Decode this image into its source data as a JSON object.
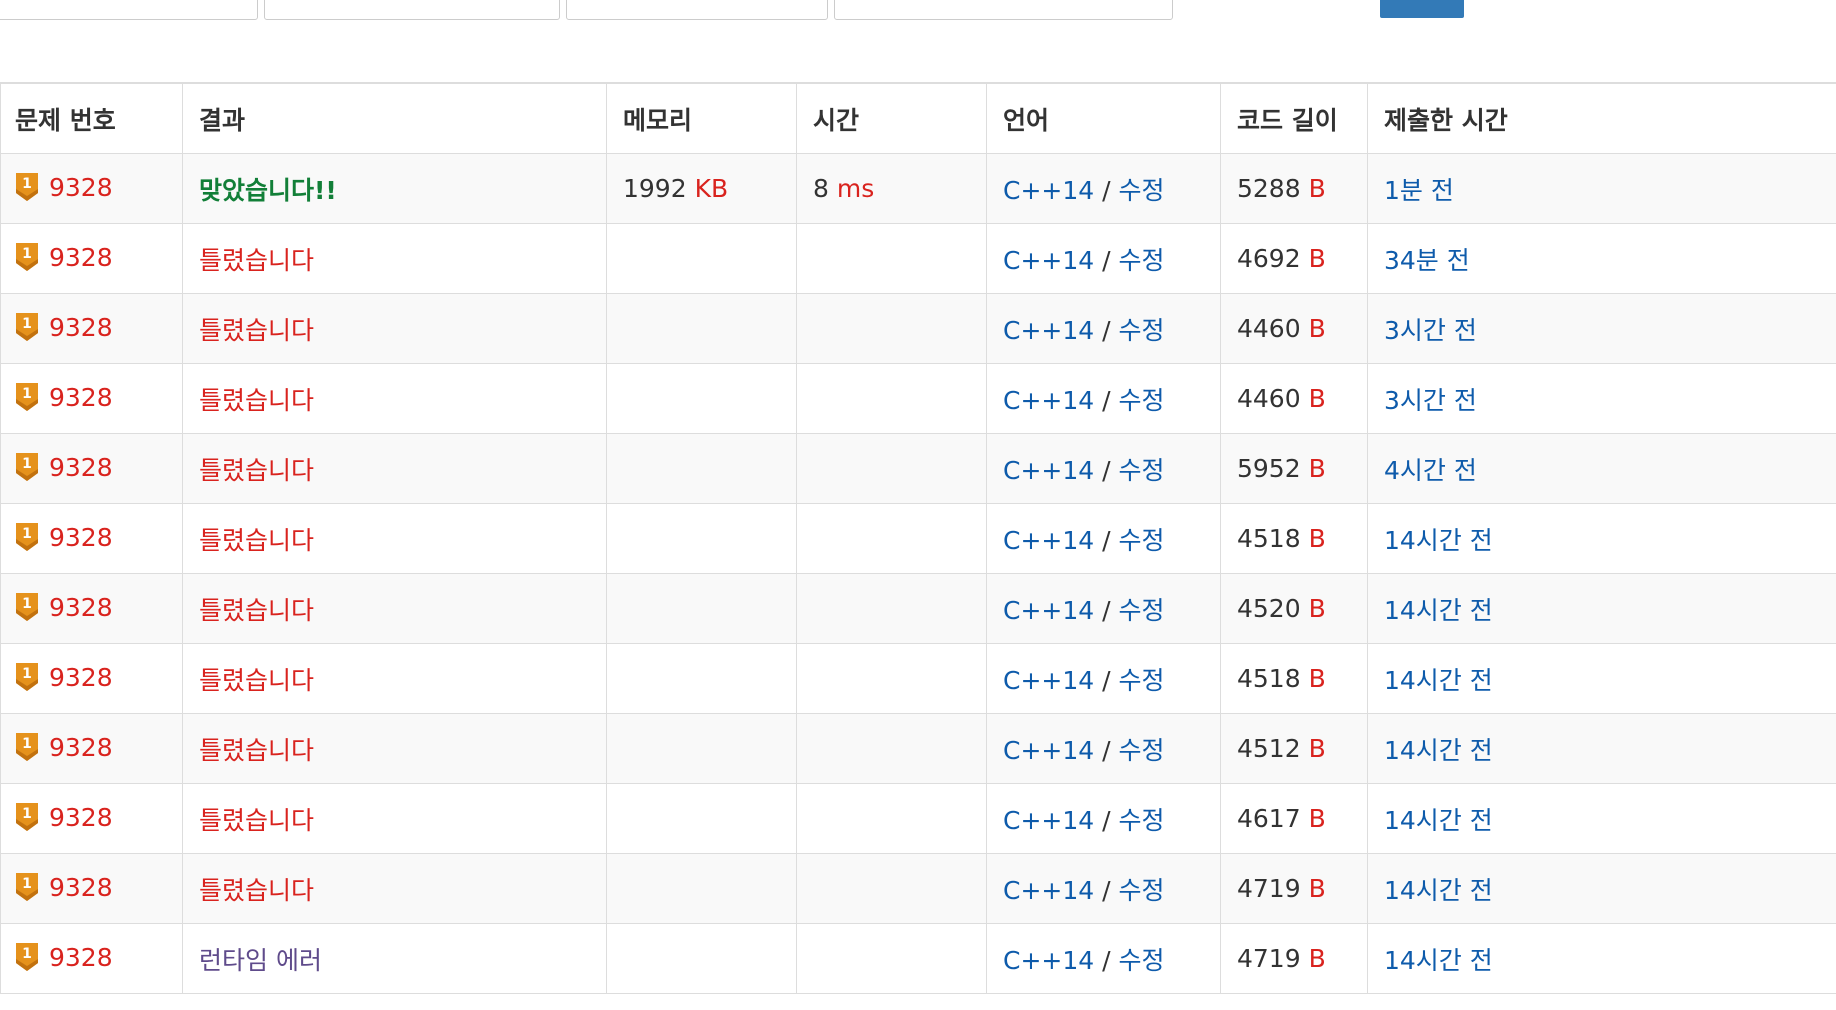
{
  "colors": {
    "accent": "#337ab7",
    "link": "#0e5bab",
    "unit_red": "#d9231e",
    "accepted_green": "#127f38",
    "runtime_error": "#5f4b8b",
    "tier_badge": "#e5921c"
  },
  "headers": {
    "problem": "문제 번호",
    "result": "결과",
    "memory": "메모리",
    "time": "시간",
    "language": "언어",
    "code_length": "코드 길이",
    "submitted": "제출한 시간"
  },
  "rows": [
    {
      "problem_id": "9328",
      "tier_icon": "silver-1-badge-icon",
      "result": "맞았습니다!!",
      "status": "ok",
      "memory": "1992",
      "memory_unit": "KB",
      "time": "8",
      "time_unit": "ms",
      "language": "C++14",
      "separator": "/",
      "edit": "수정",
      "code_length": "5288",
      "length_unit": "B",
      "submitted": "1분 전"
    },
    {
      "problem_id": "9328",
      "tier_icon": "silver-1-badge-icon",
      "result": "틀렸습니다",
      "status": "wa",
      "memory": "",
      "memory_unit": "",
      "time": "",
      "time_unit": "",
      "language": "C++14",
      "separator": "/",
      "edit": "수정",
      "code_length": "4692",
      "length_unit": "B",
      "submitted": "34분 전"
    },
    {
      "problem_id": "9328",
      "tier_icon": "silver-1-badge-icon",
      "result": "틀렸습니다",
      "status": "wa",
      "memory": "",
      "memory_unit": "",
      "time": "",
      "time_unit": "",
      "language": "C++14",
      "separator": "/",
      "edit": "수정",
      "code_length": "4460",
      "length_unit": "B",
      "submitted": "3시간 전"
    },
    {
      "problem_id": "9328",
      "tier_icon": "silver-1-badge-icon",
      "result": "틀렸습니다",
      "status": "wa",
      "memory": "",
      "memory_unit": "",
      "time": "",
      "time_unit": "",
      "language": "C++14",
      "separator": "/",
      "edit": "수정",
      "code_length": "4460",
      "length_unit": "B",
      "submitted": "3시간 전"
    },
    {
      "problem_id": "9328",
      "tier_icon": "silver-1-badge-icon",
      "result": "틀렸습니다",
      "status": "wa",
      "memory": "",
      "memory_unit": "",
      "time": "",
      "time_unit": "",
      "language": "C++14",
      "separator": "/",
      "edit": "수정",
      "code_length": "5952",
      "length_unit": "B",
      "submitted": "4시간 전"
    },
    {
      "problem_id": "9328",
      "tier_icon": "silver-1-badge-icon",
      "result": "틀렸습니다",
      "status": "wa",
      "memory": "",
      "memory_unit": "",
      "time": "",
      "time_unit": "",
      "language": "C++14",
      "separator": "/",
      "edit": "수정",
      "code_length": "4518",
      "length_unit": "B",
      "submitted": "14시간 전"
    },
    {
      "problem_id": "9328",
      "tier_icon": "silver-1-badge-icon",
      "result": "틀렸습니다",
      "status": "wa",
      "memory": "",
      "memory_unit": "",
      "time": "",
      "time_unit": "",
      "language": "C++14",
      "separator": "/",
      "edit": "수정",
      "code_length": "4520",
      "length_unit": "B",
      "submitted": "14시간 전"
    },
    {
      "problem_id": "9328",
      "tier_icon": "silver-1-badge-icon",
      "result": "틀렸습니다",
      "status": "wa",
      "memory": "",
      "memory_unit": "",
      "time": "",
      "time_unit": "",
      "language": "C++14",
      "separator": "/",
      "edit": "수정",
      "code_length": "4518",
      "length_unit": "B",
      "submitted": "14시간 전"
    },
    {
      "problem_id": "9328",
      "tier_icon": "silver-1-badge-icon",
      "result": "틀렸습니다",
      "status": "wa",
      "memory": "",
      "memory_unit": "",
      "time": "",
      "time_unit": "",
      "language": "C++14",
      "separator": "/",
      "edit": "수정",
      "code_length": "4512",
      "length_unit": "B",
      "submitted": "14시간 전"
    },
    {
      "problem_id": "9328",
      "tier_icon": "silver-1-badge-icon",
      "result": "틀렸습니다",
      "status": "wa",
      "memory": "",
      "memory_unit": "",
      "time": "",
      "time_unit": "",
      "language": "C++14",
      "separator": "/",
      "edit": "수정",
      "code_length": "4617",
      "length_unit": "B",
      "submitted": "14시간 전"
    },
    {
      "problem_id": "9328",
      "tier_icon": "silver-1-badge-icon",
      "result": "틀렸습니다",
      "status": "wa",
      "memory": "",
      "memory_unit": "",
      "time": "",
      "time_unit": "",
      "language": "C++14",
      "separator": "/",
      "edit": "수정",
      "code_length": "4719",
      "length_unit": "B",
      "submitted": "14시간 전"
    },
    {
      "problem_id": "9328",
      "tier_icon": "silver-1-badge-icon",
      "result": "런타임 에러",
      "status": "rte",
      "memory": "",
      "memory_unit": "",
      "time": "",
      "time_unit": "",
      "language": "C++14",
      "separator": "/",
      "edit": "수정",
      "code_length": "4719",
      "length_unit": "B",
      "submitted": "14시간 전"
    }
  ]
}
